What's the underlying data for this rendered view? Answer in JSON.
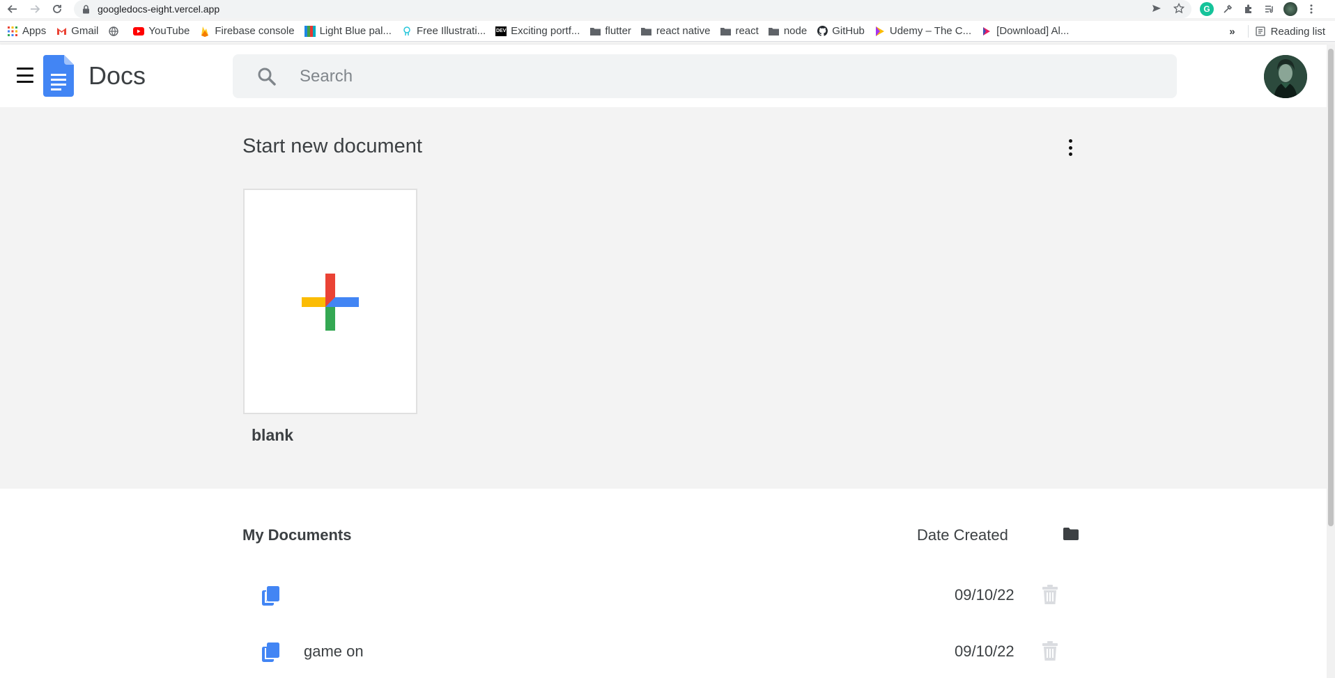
{
  "browser": {
    "url": "googledocs-eight.vercel.app",
    "bookmarks": [
      {
        "label": "Apps",
        "icon": "apps-grid-icon"
      },
      {
        "label": "Gmail",
        "icon": "gmail-icon"
      },
      {
        "label": "",
        "icon": "globe-icon"
      },
      {
        "label": "YouTube",
        "icon": "youtube-icon"
      },
      {
        "label": "Firebase console",
        "icon": "firebase-icon"
      },
      {
        "label": "Light Blue pal...",
        "icon": "palette-icon"
      },
      {
        "label": "Free Illustrati...",
        "icon": "illustration-icon"
      },
      {
        "label": "Exciting portf...",
        "icon": "dev-icon"
      },
      {
        "label": "flutter",
        "icon": "folder-icon"
      },
      {
        "label": "react native",
        "icon": "folder-icon"
      },
      {
        "label": "react",
        "icon": "folder-icon"
      },
      {
        "label": "node",
        "icon": "folder-icon"
      },
      {
        "label": "GitHub",
        "icon": "github-icon"
      },
      {
        "label": "Udemy – The C...",
        "icon": "udemy-icon"
      },
      {
        "label": "[Download] Al...",
        "icon": "download-icon"
      }
    ],
    "overflow_label": "»",
    "reading_list": "Reading list"
  },
  "header": {
    "title": "Docs",
    "search_placeholder": "Search"
  },
  "start": {
    "title": "Start new document",
    "template_label": "blank"
  },
  "documents": {
    "title": "My Documents",
    "date_header": "Date Created",
    "rows": [
      {
        "name": "",
        "date": "09/10/22"
      },
      {
        "name": "game on",
        "date": "09/10/22"
      }
    ]
  },
  "colors": {
    "docs_blue": "#4285f4",
    "plus_red": "#ea4335",
    "plus_yellow": "#fbbc04",
    "plus_green": "#34a853",
    "plus_blue": "#4285f4"
  }
}
